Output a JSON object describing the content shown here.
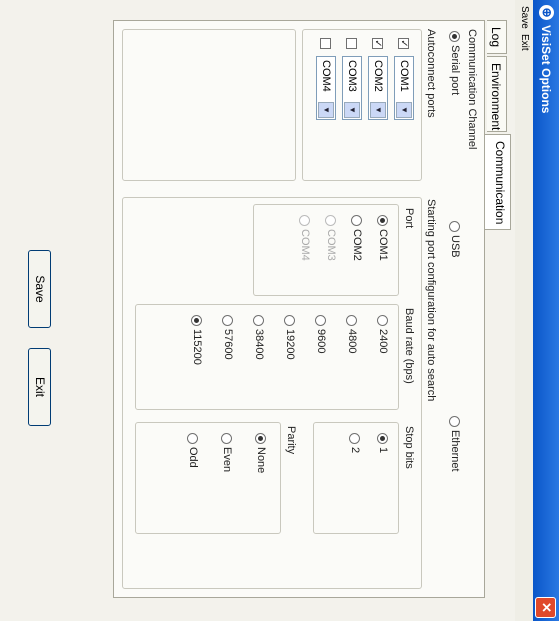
{
  "window": {
    "title": "VisiSet Options"
  },
  "menu": {
    "items": [
      "Save",
      "Exit"
    ]
  },
  "tabs": [
    "Log",
    "Environment",
    "Communication"
  ],
  "comm": {
    "channel_label": "Communication Channel",
    "options": [
      "Serial port",
      "USB",
      "Ethernet"
    ],
    "selected": "Serial port"
  },
  "autoconnect": {
    "label": "Autoconnect ports",
    "ports": [
      {
        "name": "COM1",
        "checked": true
      },
      {
        "name": "COM2",
        "checked": true
      },
      {
        "name": "COM3",
        "checked": false
      },
      {
        "name": "COM4",
        "checked": false
      }
    ]
  },
  "starting": {
    "label": "Starting port configuration for auto search",
    "port_label": "Port",
    "ports": [
      "COM1",
      "COM2",
      "COM3",
      "COM4"
    ],
    "port_selected": "COM1",
    "baud_label": "Baud rate (bps)",
    "bauds": [
      "2400",
      "4800",
      "9600",
      "19200",
      "38400",
      "57600",
      "115200"
    ],
    "baud_selected": "115200",
    "stop_label": "Stop bits",
    "stops": [
      "1",
      "2"
    ],
    "stop_selected": "1",
    "parity_label": "Parity",
    "parities": [
      "None",
      "Even",
      "Odd"
    ],
    "parity_selected": "None"
  },
  "buttons": {
    "save": "Save",
    "exit": "Exit"
  }
}
